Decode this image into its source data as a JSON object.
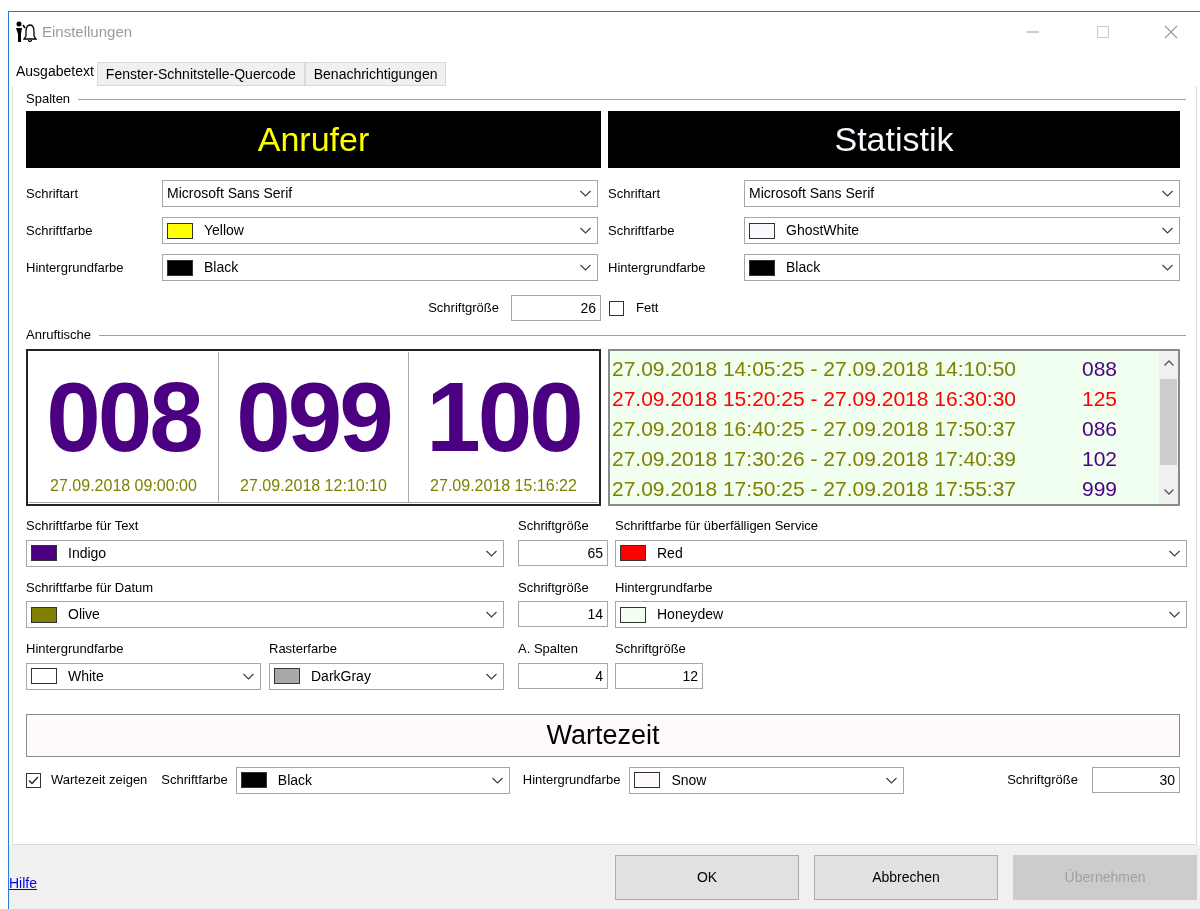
{
  "window": {
    "title": "Einstellungen"
  },
  "tabs": [
    {
      "label": "Ausgabetext",
      "selected": true
    },
    {
      "label": "Fenster-Schnitstelle-Quercode",
      "selected": false
    },
    {
      "label": "Benachrichtigungen",
      "selected": false
    }
  ],
  "spalten": {
    "heading": "Spalten",
    "panels": [
      {
        "title": "Anrufer",
        "fields": [
          {
            "label": "Schriftart",
            "value": "Microsoft Sans Serif"
          },
          {
            "label": "Schriftfarbe",
            "value": "Yellow",
            "color": "#ffff00"
          },
          {
            "label": "Hintergrundfarbe",
            "value": "Black",
            "color": "#000000"
          }
        ]
      },
      {
        "title": "Statistik",
        "fields": [
          {
            "label": "Schriftart",
            "value": "Microsoft Sans Serif"
          },
          {
            "label": "Schriftfarbe",
            "value": "GhostWhite",
            "color": "#f8f8ff"
          },
          {
            "label": "Hintergrundfarbe",
            "value": "Black",
            "color": "#000000"
          }
        ]
      }
    ],
    "font_size": {
      "label": "Schriftgröße",
      "value": "26"
    },
    "bold": {
      "label": "Fett",
      "checked": false
    }
  },
  "anruftische": {
    "heading": "Anruftische",
    "tiles": [
      {
        "number": "008",
        "date": "27.09.2018 09:00:00"
      },
      {
        "number": "099",
        "date": "27.09.2018 12:10:10"
      },
      {
        "number": "100",
        "date": "27.09.2018 15:16:22"
      }
    ],
    "list_rows": [
      {
        "text": "27.09.2018 14:05:25 - 27.09.2018 14:10:50",
        "number": "088",
        "overdue": false
      },
      {
        "text": "27.09.2018 15:20:25 - 27.09.2018 16:30:30",
        "number": "125",
        "overdue": true
      },
      {
        "text": "27.09.2018 16:40:25 - 27.09.2018 17:50:37",
        "number": "086",
        "overdue": false
      },
      {
        "text": "27.09.2018 17:30:26 - 27.09.2018 17:40:39",
        "number": "102",
        "overdue": false
      },
      {
        "text": "27.09.2018 17:50:25 - 27.09.2018 17:55:37",
        "number": "999",
        "overdue": false
      }
    ],
    "text_color": {
      "label": "Schriftfarbe für Text",
      "value": "Indigo",
      "color": "#4b0082"
    },
    "text_size": {
      "label": "Schriftgröße",
      "value": "65"
    },
    "overdue_color": {
      "label": "Schriftfarbe für überfälligen Service",
      "value": "Red",
      "color": "#ff0000"
    },
    "date_color": {
      "label": "Schriftfarbe für Datum",
      "value": "Olive",
      "color": "#808000"
    },
    "date_size": {
      "label": "Schriftgröße",
      "value": "14"
    },
    "list_background": {
      "label": "Hintergrundfarbe",
      "value": "Honeydew",
      "color": "#f0fff0"
    },
    "tile_background": {
      "label": "Hintergrundfarbe",
      "value": "White",
      "color": "#ffffff"
    },
    "grid_color": {
      "label": "Rasterfarbe",
      "value": "DarkGray",
      "color": "#a9a9a9"
    },
    "columns": {
      "label": "A. Spalten",
      "value": "4"
    },
    "list_size": {
      "label": "Schriftgröße",
      "value": "12"
    }
  },
  "wartezeit": {
    "title": "Wartezeit",
    "show": {
      "label": "Wartezeit zeigen",
      "checked": true
    },
    "font_color": {
      "label": "Schriftfarbe",
      "value": "Black",
      "color": "#000000"
    },
    "background": {
      "label": "Hintergrundfarbe",
      "value": "Snow",
      "color": "#fffafa"
    },
    "font_size": {
      "label": "Schriftgröße",
      "value": "30"
    }
  },
  "footer": {
    "help": "Hilfe",
    "buttons": [
      {
        "label": "OK",
        "disabled": false
      },
      {
        "label": "Abbrechen",
        "disabled": false
      },
      {
        "label": "Übernehmen",
        "disabled": true
      }
    ]
  }
}
